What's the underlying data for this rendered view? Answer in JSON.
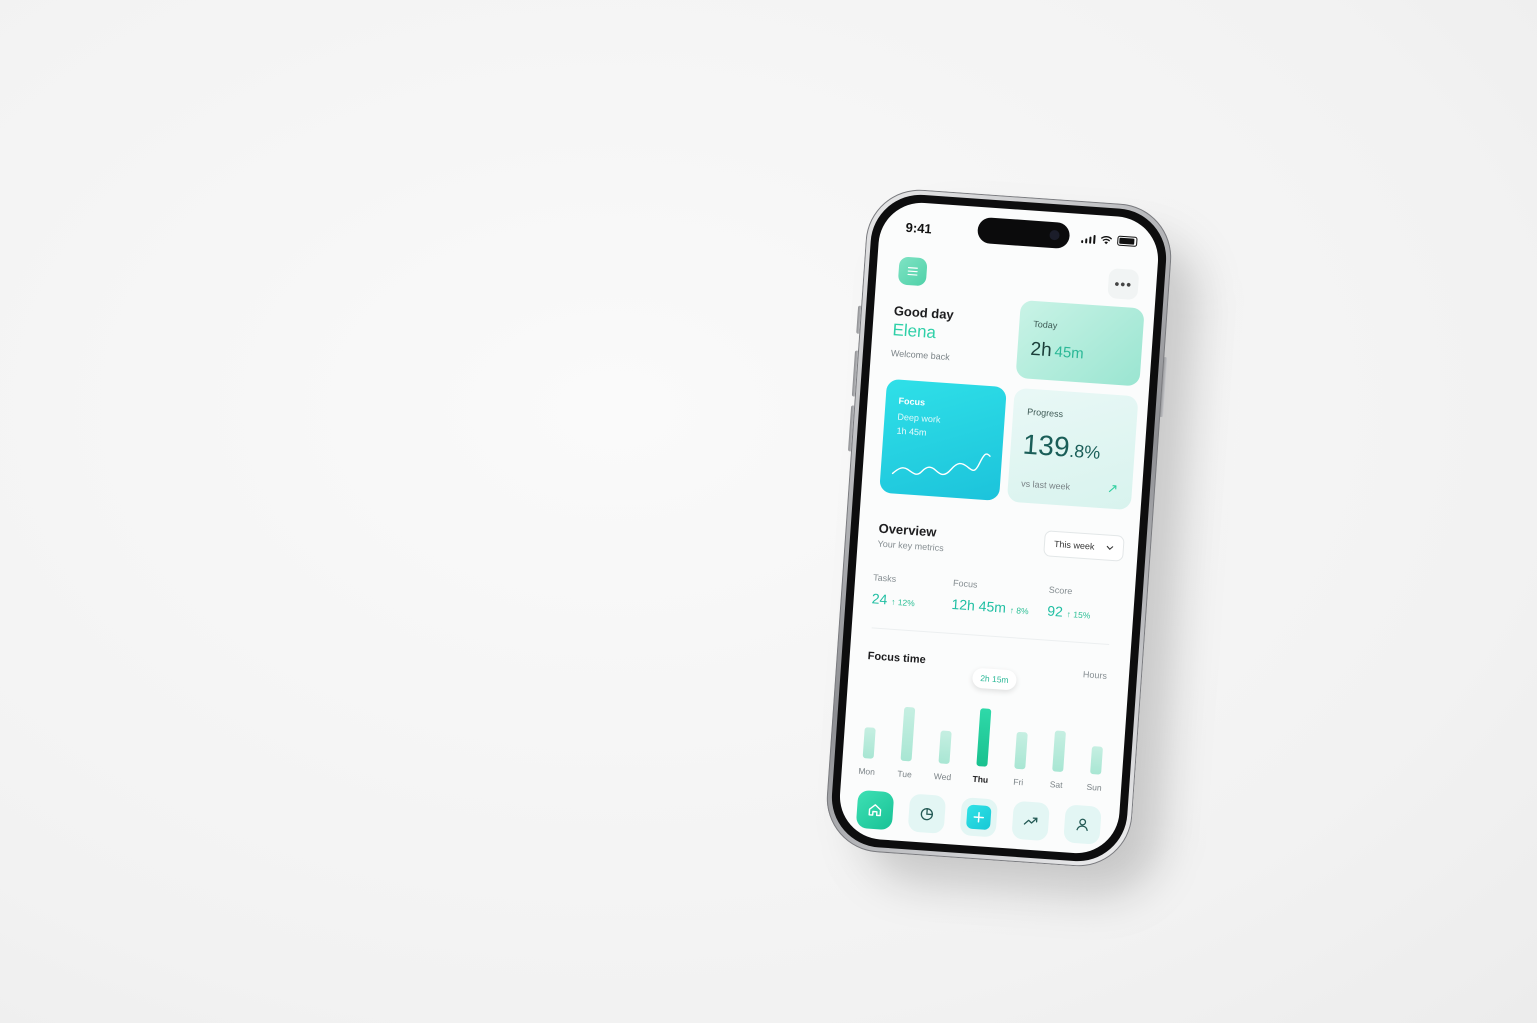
{
  "status_bar": {
    "time": "9:41"
  },
  "greeting": {
    "line1": "Good day",
    "name": "Elena",
    "sub": "Welcome back"
  },
  "today_card": {
    "label": "Today",
    "hours": "2h",
    "minutes": "45m"
  },
  "focus_card": {
    "title": "Focus",
    "subtitle": "Deep work",
    "duration": "1h 45m"
  },
  "progress_card": {
    "label": "Progress",
    "value_int": "139",
    "value_dec": ".8%",
    "caption": "vs last week"
  },
  "overview": {
    "title": "Overview",
    "subtitle": "Your key metrics",
    "range_selector": "This week",
    "metrics": [
      {
        "label": "Tasks",
        "value": "24",
        "change": "↑ 12%"
      },
      {
        "label": "Focus",
        "value": "12h 45m",
        "change": "↑ 8%"
      },
      {
        "label": "Score",
        "value": "92",
        "change": "↑ 15%"
      }
    ]
  },
  "focus_time": {
    "title": "Focus time",
    "unit": "Hours",
    "tooltip": "2h 15m"
  },
  "chart_data": {
    "type": "bar",
    "categories": [
      "Mon",
      "Tue",
      "Wed",
      "Thu",
      "Fri",
      "Sat",
      "Sun"
    ],
    "values": [
      1.2,
      2.1,
      1.3,
      2.25,
      1.45,
      1.6,
      1.1
    ],
    "active_index": 3,
    "ylim": [
      0,
      2.5
    ],
    "grid": false
  },
  "colors": {
    "accent": "#2fd0a8",
    "cyan": "#1cc3db",
    "mint_light": "#c6efe2"
  }
}
